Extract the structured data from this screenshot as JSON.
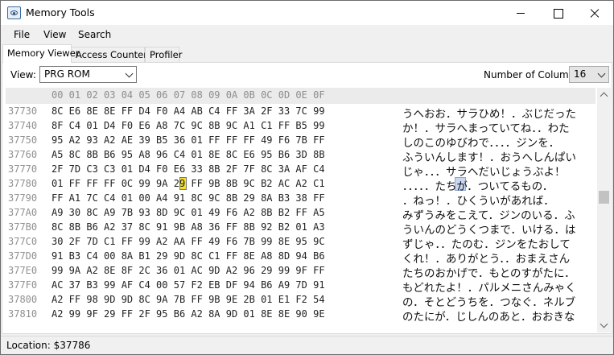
{
  "window": {
    "title": "Memory Tools",
    "app_icon": "eye-icon"
  },
  "menu": [
    "File",
    "View",
    "Search"
  ],
  "tabs": [
    "Memory Viewer",
    "Access Counters",
    "Profiler"
  ],
  "toolbar": {
    "view_label": "View:",
    "view_value": "PRG ROM",
    "columns_label": "Number of Columns:",
    "columns_value": "16"
  },
  "hex": {
    "header": "00 01 02 03 04 05 06 07 08 09 0A 0B 0C 0D 0E 0F",
    "rows": [
      {
        "addr": "37730",
        "bytes": "8C E6 8E 8E FF D4 F0 A4 AB C4 FF 3A 2F 33 7C 99",
        "text": "うへおお．サラひめ！．ぶじだった"
      },
      {
        "addr": "37740",
        "bytes": "8F C4 01 D4 F0 E6 A8 7C 9C 8B 9C A1 C1 FF B5 99",
        "text": "か！．サラへまっていてね．．わた"
      },
      {
        "addr": "37750",
        "bytes": "95 A2 93 A2 AE 39 B5 36 01 FF FF FF 49 F6 7B FF",
        "text": "しのこのゆびわで．．．．ジンを．"
      },
      {
        "addr": "37760",
        "bytes": "A5 8C 8B B6 95 A8 96 C4 01 8E 8C E6 95 B6 3D 8B",
        "text": "ふういんします！．おうへしんぱい"
      },
      {
        "addr": "37770",
        "bytes": "2F 7D C3 C3 01 D4 F0 E6 33 8B 2F 7F 8C 3A AF C4",
        "text": "じゃ．．．サラへだいじょうぶよ！"
      },
      {
        "addr": "37780",
        "bytes": "01 FF FF FF 0C 99 9A 29 FF 9B 8B 9C B2 AC A2 C1",
        "text": "．．．．．たちが．ついてるもの．"
      },
      {
        "addr": "37790",
        "bytes": "FF A1 7C C4 01 00 A4 91 8C 9C 8B 29 8A B3 38 FF",
        "text": "．ねっ！．ひくういがあれば．"
      },
      {
        "addr": "377A0",
        "bytes": "A9 30 8C A9 7B 93 8D 9C 01 49 F6 A2 8B B2 FF A5",
        "text": "みずうみをこえて．ジンのいる．ふ"
      },
      {
        "addr": "377B0",
        "bytes": "8C 8B B6 A2 37 8C 91 9B A8 36 FF 8B 92 B2 01 A3",
        "text": "ういんのどうくつまで．いける．は"
      },
      {
        "addr": "377C0",
        "bytes": "30 2F 7D C1 FF 99 A2 AA FF 49 F6 7B 99 8E 95 9C",
        "text": "ずじゃ．．たのむ．ジンをたおして"
      },
      {
        "addr": "377D0",
        "bytes": "91 B3 C4 00 8A B1 29 9D 8C C1 FF 8E A8 8D 94 B6",
        "text": "くれ！．ありがとう．．おまえさん"
      },
      {
        "addr": "377E0",
        "bytes": "99 9A A2 8E 8F 2C 36 01 AC 9D A2 96 29 99 9F FF",
        "text": "たちのおかげで．もとのすがたに．"
      },
      {
        "addr": "377F0",
        "bytes": "AC 37 B3 99 AF C4 00 57 F2 EB DF 94 B6 A9 7D 91",
        "text": "もどれたよ！．パルメニさんみゃく"
      },
      {
        "addr": "37800",
        "bytes": "A2 FF 98 9D 9D 8C 9A 7B FF 9B 9E 2B 01 E1 F2 54",
        "text": "の．そとどうちを．つなぐ．ネルブ"
      },
      {
        "addr": "37810",
        "bytes": "A2 99 9F 29 FF 2F 95 B6 A2 8A 9D 01 8E 8E 90 9E",
        "text": "のたにが．じしんのあと．おおきな"
      }
    ]
  },
  "status": {
    "location": "Location: $37786"
  },
  "colors": {
    "cursor_highlight": "#f2e12a",
    "ascii_highlight": "#c9d8f0",
    "address": "#909090"
  }
}
